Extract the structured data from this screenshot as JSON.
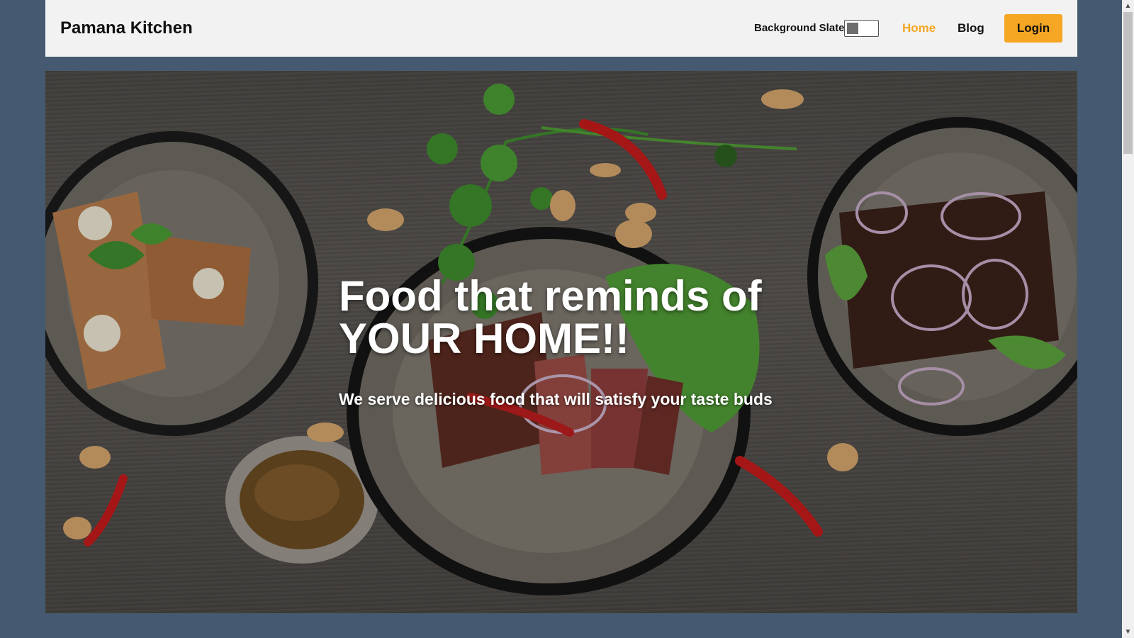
{
  "navbar": {
    "brand": "Pamana Kitchen",
    "background_toggle_label": "Background Slate",
    "links": [
      {
        "label": "Home",
        "active": true
      },
      {
        "label": "Blog",
        "active": false
      }
    ],
    "login_label": "Login",
    "accent_color": "#f5a623"
  },
  "hero": {
    "title_line1": "Food that reminds of",
    "title_line2": "YOUR HOME!!",
    "subtitle": "We serve delicious food that will satisfy your taste buds"
  },
  "colors": {
    "page_background": "#455a70",
    "navbar_background": "#f2f2f2"
  },
  "icons": {
    "scroll_up": "scroll-up-arrow-icon",
    "scroll_down": "scroll-down-arrow-icon"
  }
}
